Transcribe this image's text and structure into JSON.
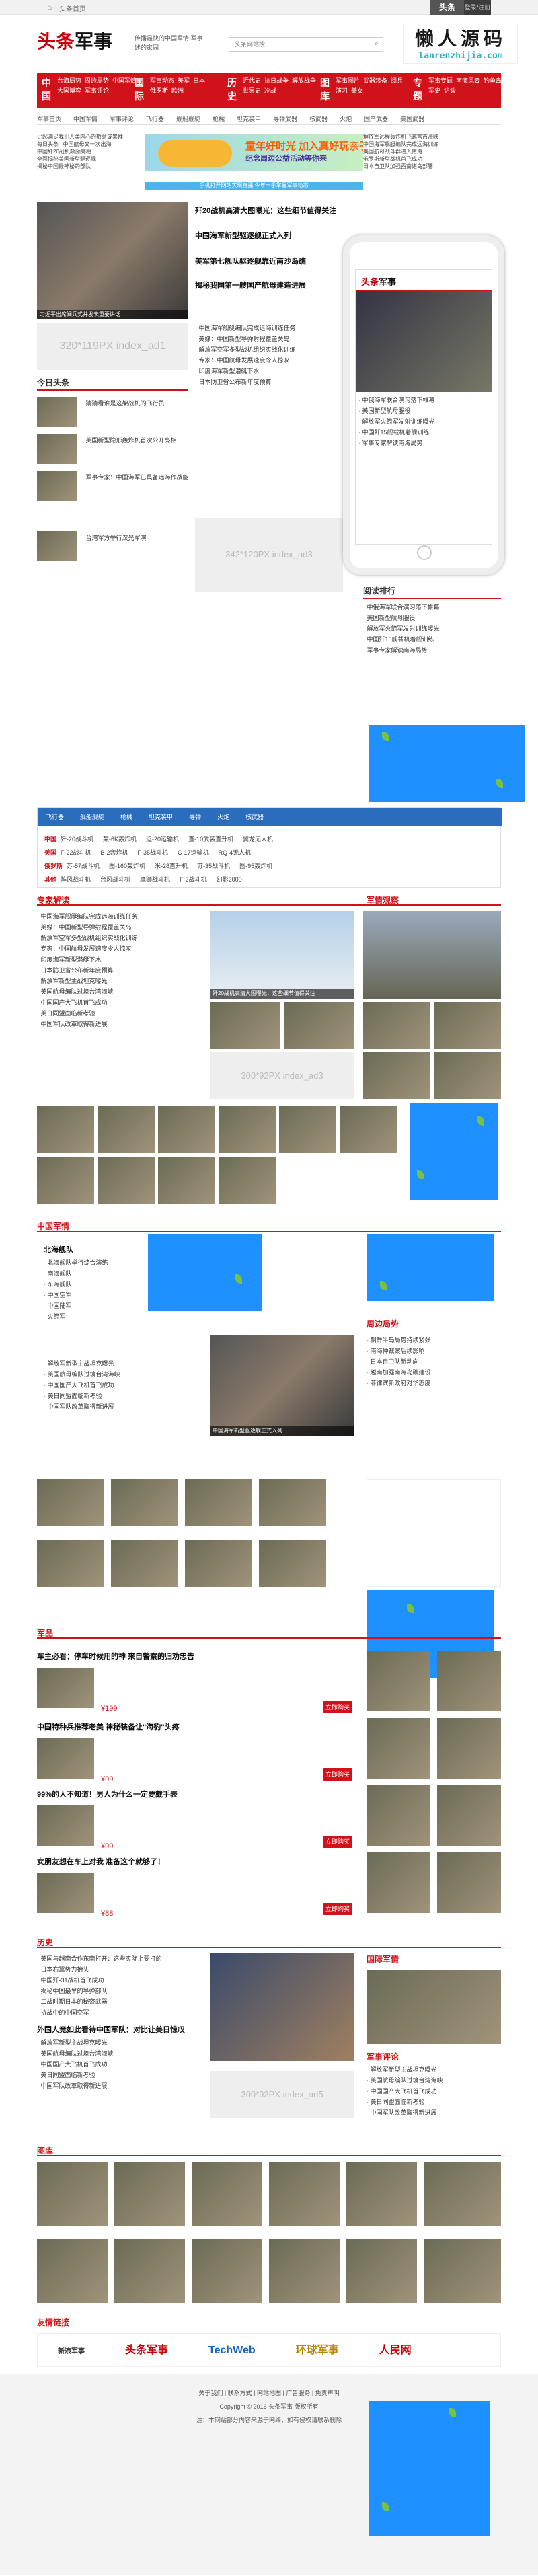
{
  "top": {
    "home_label": "头条首页",
    "btn1": "头条",
    "btn2": "登录/注册"
  },
  "logo": {
    "red": "头条",
    "black": "军事"
  },
  "slogan": "传播最快的中国军情 军事迷的家园",
  "search": {
    "placeholder": "头条网站搜"
  },
  "brand": {
    "name": "懒人源码",
    "url": "lanrenzhijia.com"
  },
  "nav": [
    {
      "head": "中国",
      "links": [
        "台海局势",
        "周边局势",
        "中国军情",
        "大国博弈",
        "军事评论"
      ]
    },
    {
      "head": "国际",
      "links": [
        "军事动态",
        "美军",
        "日本",
        "俄罗斯",
        "欧洲"
      ]
    },
    {
      "head": "历史",
      "links": [
        "近代史",
        "抗日战争",
        "解放战争",
        "世界史",
        "冷战"
      ]
    },
    {
      "head": "图库",
      "links": [
        "军事图片",
        "武器装备",
        "阅兵",
        "演习",
        "美女"
      ]
    },
    {
      "head": "专题",
      "links": [
        "军事专题",
        "南海风云",
        "钓鱼岛",
        "军史",
        "访谈"
      ]
    }
  ],
  "subnav": [
    "军事首页",
    "中国军情",
    "军事评论",
    "飞行器",
    "舰船舰艇",
    "枪械",
    "坦克装甲",
    "导弹武器",
    "核武器",
    "火炮",
    "国产武器",
    "美国武器",
    "俄罗斯武器",
    "军事图片"
  ],
  "banner": {
    "t1": "童年好时光 加入真好玩亲子群!",
    "t2": "纪念周边公益活动等你来"
  },
  "strip": "手机打开网站实现直播 今年一手掌握军事动态",
  "top_news": [
    "比起满足我们人类内心的敬意或崇拜",
    "每日头条 | 中国航母又一次出海",
    "中国歼20战机频频亮相",
    "全面揭秘美国新型驱逐舰",
    "揭秘中国最神秘的部队"
  ],
  "right_news": [
    "解放军远程轰炸机飞越宫古海峡",
    "中国海军舰艇编队完成远海训练",
    "美国航母战斗群进入南海",
    "俄罗斯新型战机首飞成功",
    "日本自卫队加强西南诸岛部署"
  ],
  "main_headline": "习近平出席阅兵式并发表重要讲话",
  "headlines": [
    "歼20战机高清大图曝光：这些细节值得关注",
    "中国海军新型驱逐舰正式入列",
    "美军第七舰队驱逐舰靠近南沙岛礁",
    "揭秘我国第一艘国产航母建造进展"
  ],
  "today": {
    "title": "今日头条",
    "items": [
      "猜猜看谁是这架战机的飞行员",
      "美国新型隐形轰炸机首次公开亮相",
      "军事专家：中国海军已具备远海作战能力",
      "台湾军方举行汉光军演"
    ]
  },
  "placeholder1": "320*119PX index_ad1",
  "placeholder2": "342*120PX index_ad3",
  "placeholder3": "300*92PX index_ad3",
  "placeholder4": "300*92PX index_ad5",
  "ranking": {
    "title": "阅读排行",
    "items": [
      "中俄海军联合演习落下帷幕",
      "美国新型航母服役",
      "解放军火箭军发射训练曝光",
      "中国歼15舰载机着舰训练",
      "军事专家解读南海局势"
    ]
  },
  "sections": {
    "s1": "专家解读",
    "s2": "军情观察",
    "s3": "中国军情",
    "s4": "周边局势",
    "s5": "国际",
    "s6": "国际军情",
    "s7": "军品",
    "s8": "历史",
    "s9": "军事评论",
    "s10": "图库",
    "s11": "友情链接"
  },
  "weapons": {
    "tabs": [
      "飞行器",
      "舰船舰艇",
      "枪械",
      "坦克装甲",
      "导弹",
      "火炮",
      "核武器"
    ],
    "rows": [
      {
        "c": "中国",
        "items": [
          "歼-20战斗机",
          "轰-6K轰炸机",
          "运-20运输机",
          "直-10武装直升机",
          "翼龙无人机"
        ]
      },
      {
        "c": "美国",
        "items": [
          "F-22战斗机",
          "B-2轰炸机",
          "F-35战斗机",
          "C-17运输机",
          "RQ-4无人机"
        ]
      },
      {
        "c": "俄罗斯",
        "items": [
          "苏-57战斗机",
          "图-160轰炸机",
          "米-28直升机",
          "苏-35战斗机",
          "图-95轰炸机"
        ]
      },
      {
        "c": "其他",
        "items": [
          "阵风战斗机",
          "台风战斗机",
          "鹰狮战斗机",
          "F-2战斗机",
          "幻影2000"
        ]
      }
    ]
  },
  "s1_items": [
    "中国海军舰艇编队完成远海训练任务",
    "美媒：中国新型导弹射程覆盖关岛",
    "解放军空军多型战机组织实战化训练",
    "专家：中国航母发展速度令人惊叹",
    "印度海军新型潜艇下水",
    "日本防卫省公布新年度预算"
  ],
  "s3_head": "北海舰队",
  "s3_items": [
    "北海舰队举行综合演练",
    "南海舰队",
    "东海舰队",
    "中国空军",
    "中国陆军",
    "火箭军"
  ],
  "s4_items": [
    "朝鲜半岛局势持续紧张",
    "南海仲裁案后续影响",
    "日本自卫队新动向",
    "越南加强南海岛礁建设",
    "菲律宾新政府对华态度"
  ],
  "s7_items": [
    {
      "t": "车主必看：停车时候用的神 来自警察的归劝忠告",
      "p": "¥199"
    },
    {
      "t": "中国特种兵推荐老美 神秘装备让\"海豹\"头疼",
      "p": "¥99"
    },
    {
      "t": "99%的人不知道！男人为什么一定要戴手表",
      "p": "¥99"
    },
    {
      "t": "女朋友想在车上对我 准备这个就够了！",
      "p": "¥88"
    }
  ],
  "buy": "立即购买",
  "s8_items": [
    "美国与越南合作东南打开：这些实际上要打的",
    "日本右翼势力抬头",
    "中国歼-31战机首飞成功",
    "揭秘中国最早的导弹部队",
    "二战时期日本的秘密武器",
    "抗战中的中国空军"
  ],
  "s8_head2": "外国人竟如此看待中国军队：对比让美日惊叹",
  "s9_items": [
    "解放军新型主战坦克曝光",
    "美国航母编队过境台湾海峡",
    "中国国产大飞机首飞成功",
    "美日同盟面临新考验",
    "中国军队改革取得新进展"
  ],
  "footer": {
    "links": "关于我们 | 联系方式 | 网站地图 | 广告服务 | 免责声明",
    "copyright": "Copyright © 2016 头条军事 版权所有",
    "note": "注：本网站部分内容来源于网络，如有侵权请联系删除"
  },
  "friends": [
    "新浪军事",
    "头条军事",
    "TechWeb",
    "环球军事",
    "人民网"
  ]
}
